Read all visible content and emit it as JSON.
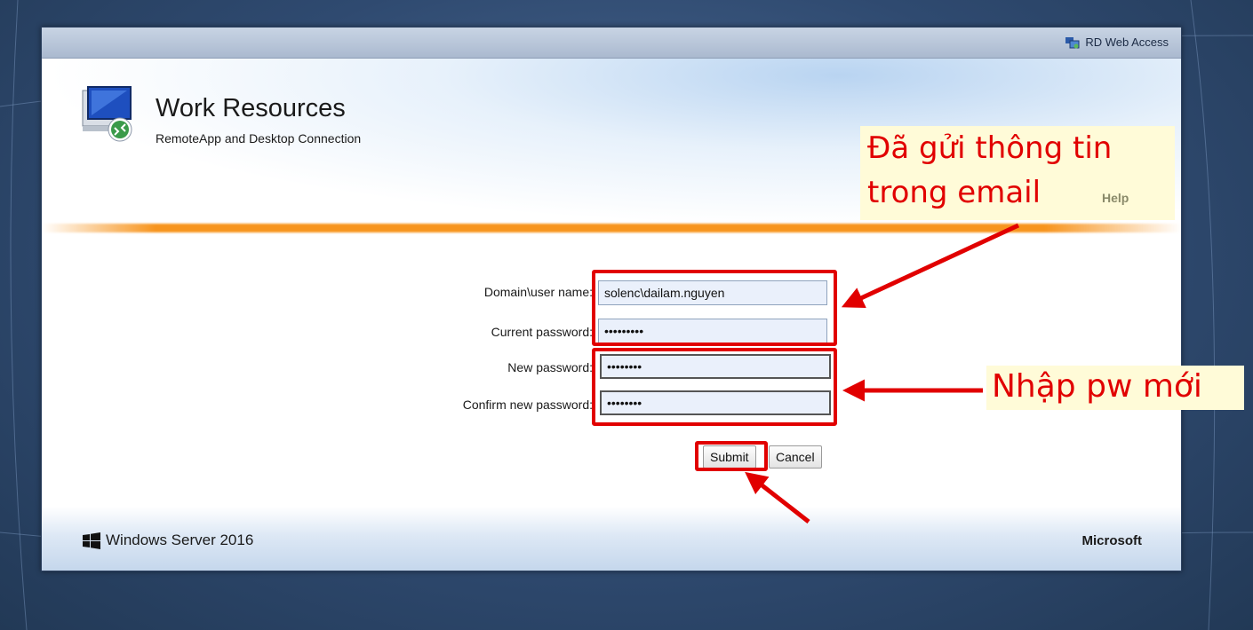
{
  "topbar": {
    "brand_label": "RD Web Access"
  },
  "header": {
    "title": "Work Resources",
    "subtitle": "RemoteApp and Desktop Connection",
    "help_label": "Help"
  },
  "form": {
    "username_label": "Domain\\user name:",
    "username_value": "solenc\\dailam.nguyen",
    "current_password_label": "Current password:",
    "current_password_value": "•••••••••",
    "new_password_label": "New password:",
    "new_password_value": "••••••••",
    "confirm_password_label": "Confirm new password:",
    "confirm_password_value": "••••••••",
    "submit_label": "Submit",
    "cancel_label": "Cancel"
  },
  "footer": {
    "product_name": "Windows Server 2016",
    "vendor": "Microsoft"
  },
  "annotations": {
    "callout_top_line1": "Đã gửi thông tin",
    "callout_top_line2": "trong email",
    "callout_right": "Nhập pw mới",
    "color": "#e10000"
  }
}
